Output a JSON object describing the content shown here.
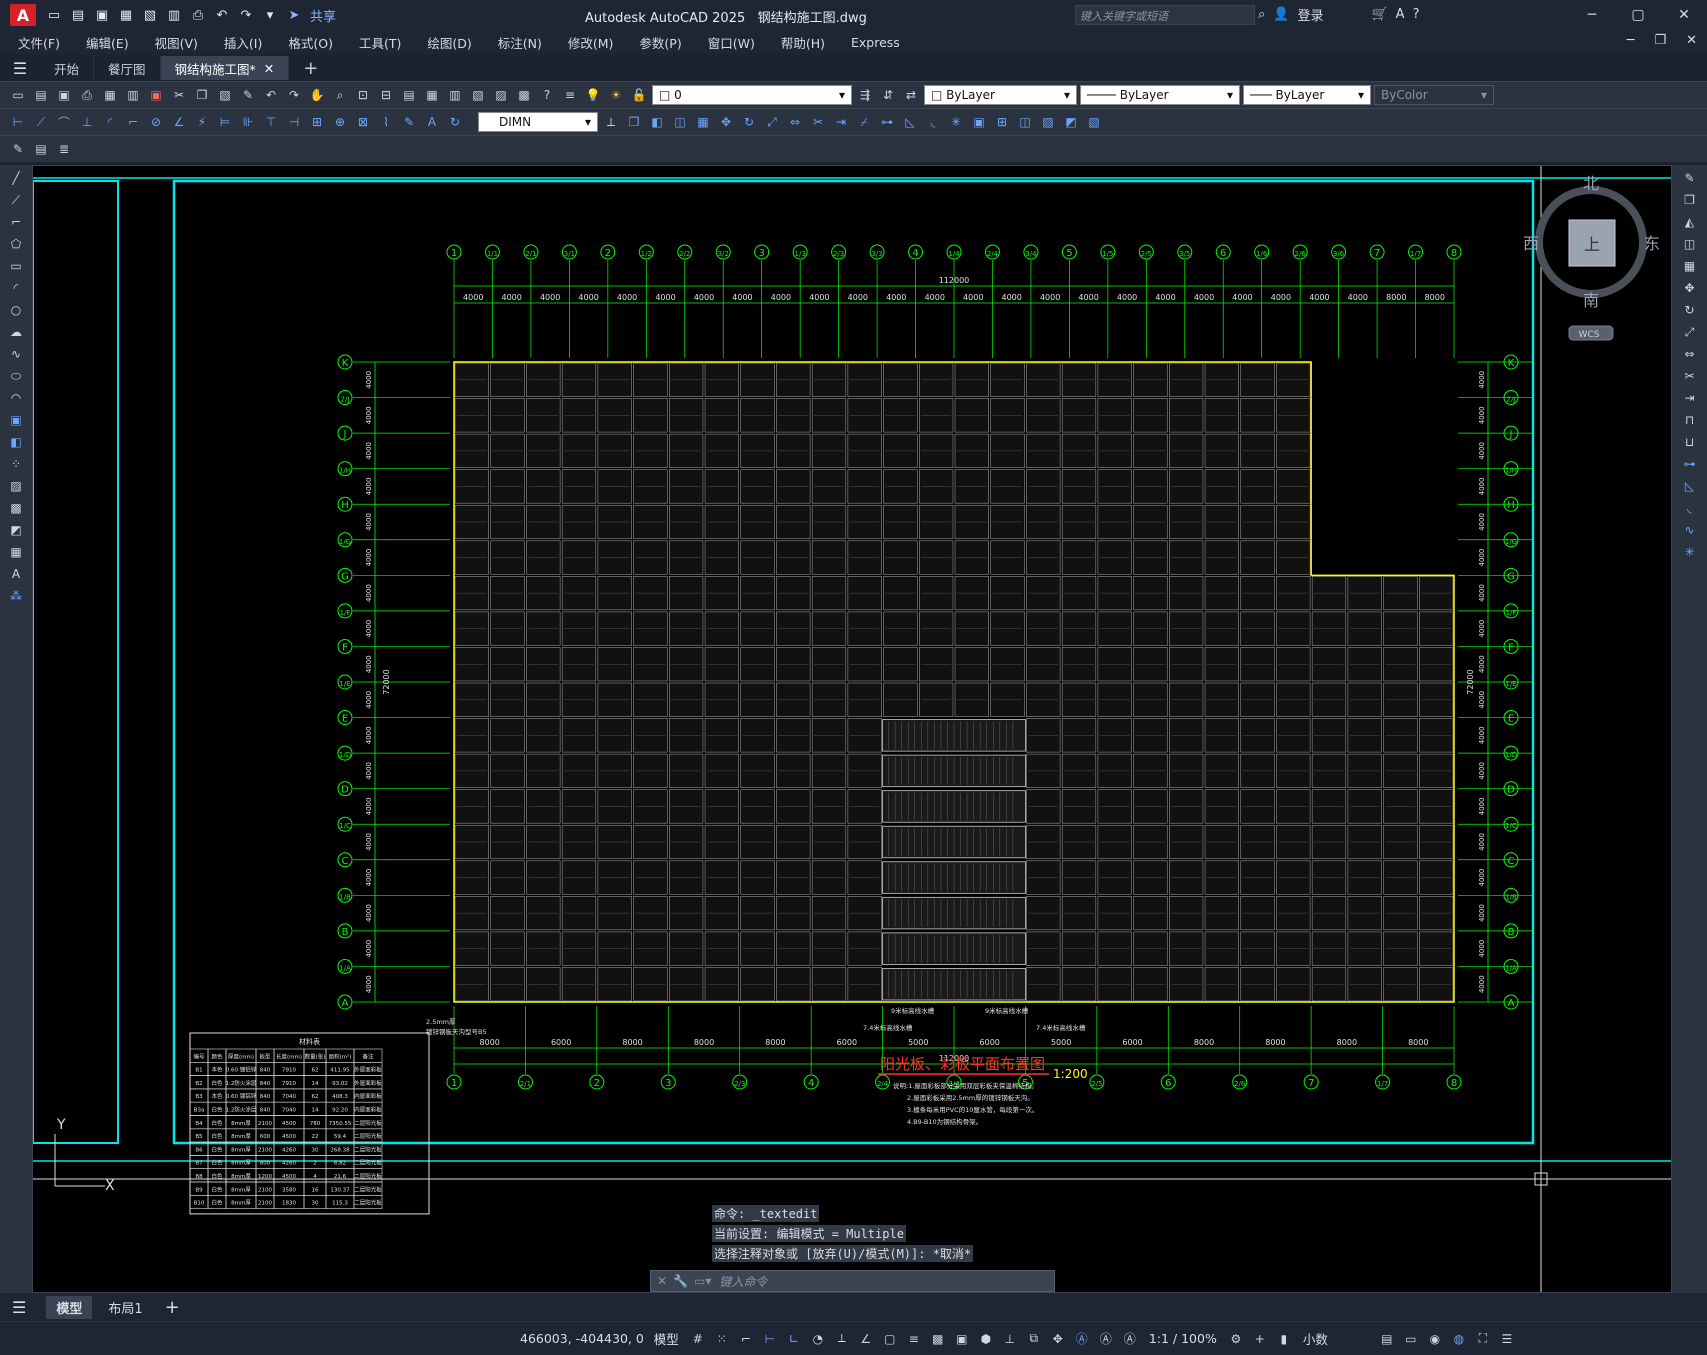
{
  "app": {
    "title": "Autodesk AutoCAD 2025",
    "file": "钢结构施工图.dwg",
    "logo_letter": "A",
    "share_label": "共享",
    "search_placeholder": "键入关键字或短语",
    "login_label": "登录"
  },
  "menu": [
    "文件(F)",
    "编辑(E)",
    "视图(V)",
    "插入(I)",
    "格式(O)",
    "工具(T)",
    "绘图(D)",
    "标注(N)",
    "修改(M)",
    "参数(P)",
    "窗口(W)",
    "帮助(H)",
    "Express"
  ],
  "tabs": [
    {
      "label": "开始",
      "active": false
    },
    {
      "label": "餐厅图",
      "active": false
    },
    {
      "label": "钢结构施工图*",
      "active": true
    }
  ],
  "toolbar": {
    "layer_value": "0",
    "color_value": "ByLayer",
    "linetype_value": "ByLayer",
    "lineweight_value": "ByLayer",
    "plotstyle_value": "ByColor",
    "dimstyle_value": "DIMN"
  },
  "viewcube": {
    "north": "北",
    "south": "南",
    "east": "东",
    "west": "西",
    "top": "上",
    "wcs": "WCS"
  },
  "drawing": {
    "title": "阳光板、彩板平面布置图",
    "scale": "1:200",
    "total_dim": "112000",
    "axis_top": [
      "1",
      "1/1",
      "2/1",
      "3/1",
      "2",
      "1/2",
      "2/2",
      "3/2",
      "3",
      "1/3",
      "2/3",
      "3/3",
      "4",
      "1/4",
      "2/4",
      "3/4",
      "5",
      "1/5",
      "2/5",
      "3/5",
      "6",
      "1/6",
      "2/6",
      "3/6",
      "7",
      "1/7",
      "8"
    ],
    "axis_bottom": [
      "1",
      "2/1",
      "2",
      "3",
      "2/3",
      "4",
      "2/4",
      "2/4",
      "5",
      "2/5",
      "6",
      "2/6",
      "7",
      "1/7",
      "8"
    ],
    "axis_left": [
      "K",
      "2/J",
      "J",
      "1/H",
      "H",
      "1/G",
      "G",
      "1/F",
      "F",
      "1/E",
      "E",
      "1/D",
      "D",
      "1/C",
      "C",
      "1/B",
      "B",
      "1/A",
      "A"
    ],
    "dims_top": [
      "4000",
      "4000",
      "4000",
      "4000",
      "4000",
      "4000",
      "4000",
      "4000",
      "4000",
      "4000",
      "4000",
      "4000",
      "4000",
      "4000",
      "4000",
      "4000",
      "4000",
      "4000",
      "4000",
      "4000",
      "4000",
      "4000",
      "4000",
      "4000",
      "8000",
      "8000"
    ],
    "dims_bottom": [
      "8000",
      "6000",
      "8000",
      "8000",
      "8000",
      "6000",
      "5000",
      "6000",
      "5000",
      "6000",
      "8000",
      "8000",
      "8000",
      "8000"
    ],
    "dims_left": [
      "4000",
      "4000",
      "4000",
      "4000",
      "4000",
      "4000",
      "4000",
      "4000",
      "4000",
      "4000",
      "4000",
      "4000",
      "4000",
      "4000",
      "4000",
      "4000",
      "4000",
      "4000"
    ],
    "side_total": "72000",
    "notes": [
      "说明:1.屋面彩板部分采用双层彩板夹保温棉结构。",
      "2.屋面彩板采用2.5mm厚的镀锌钢板天沟。",
      "3.檩条每米用PVC的10厘水管，每段第一次。",
      "4.B9-B10为钢结构骨架。"
    ],
    "note_labels": [
      "2.5mm厚",
      "镀锌钢板天沟型号B5",
      "7.4米标高线水槽",
      "9米标高线水槽",
      "9米标高线水槽",
      "7.4米标高线水槽"
    ],
    "table_title": "材料表",
    "table_headers": [
      "编号",
      "颜色",
      "厚度(mm)",
      "板型",
      "长度(mm)",
      "数量(张)",
      "面积(m²)",
      "备注"
    ],
    "table_rows": [
      [
        "B1",
        "本色",
        "0.60 镀铝锌",
        "840",
        "7910",
        "62",
        "411.95",
        "外屋面彩板"
      ],
      [
        "B2",
        "白色",
        "1.2防火涂层",
        "840",
        "7910",
        "14",
        "93.02",
        "外屋面彩板"
      ],
      [
        "B3",
        "本色",
        "0.60 镀铝锌",
        "840",
        "7040",
        "62",
        "408.3",
        "内屋面彩板"
      ],
      [
        "B3a",
        "白色",
        "1.2防火涂层",
        "840",
        "7040",
        "14",
        "92.20",
        "内屋面彩板"
      ],
      [
        "B4",
        "白色",
        "8mm厚",
        "2100",
        "4500",
        "780",
        "7350.55",
        "二层阳光板"
      ],
      [
        "B5",
        "白色",
        "8mm厚",
        "600",
        "4500",
        "22",
        "59.4",
        "二层阳光板"
      ],
      [
        "B6",
        "白色",
        "8mm厚",
        "2100",
        "4260",
        "30",
        "268.38",
        "二层阳光板"
      ],
      [
        "B7",
        "白色",
        "8mm厚",
        "800",
        "4260",
        "2",
        "6.82",
        "二层阳光板"
      ],
      [
        "B8",
        "白色",
        "8mm厚",
        "1200",
        "4500",
        "4",
        "21.6",
        "二层阳光板"
      ],
      [
        "B9",
        "白色",
        "8mm厚",
        "2100",
        "3580",
        "16",
        "130.37",
        "二层阳光板"
      ],
      [
        "B10",
        "白色",
        "8mm厚",
        "2100",
        "1830",
        "30",
        "115.3",
        "二层阳光板"
      ]
    ]
  },
  "command": {
    "history": [
      "命令: _textedit",
      "当前设置: 编辑模式 = Multiple",
      "选择注释对象或 [放弃(U)/模式(M)]: *取消*"
    ],
    "placeholder": "键入命令"
  },
  "layout_tabs": [
    {
      "label": "模型",
      "active": true
    },
    {
      "label": "布局1",
      "active": false
    }
  ],
  "status": {
    "coords": "466003, -404430, 0",
    "model_label": "模型",
    "annoscale": "1:1 / 100%",
    "units": "小数"
  },
  "colors": {
    "cyan": "#00e5e5",
    "green": "#00ff00",
    "yellow": "#ffff00",
    "red": "#ff3030",
    "canvas": "#000000"
  }
}
